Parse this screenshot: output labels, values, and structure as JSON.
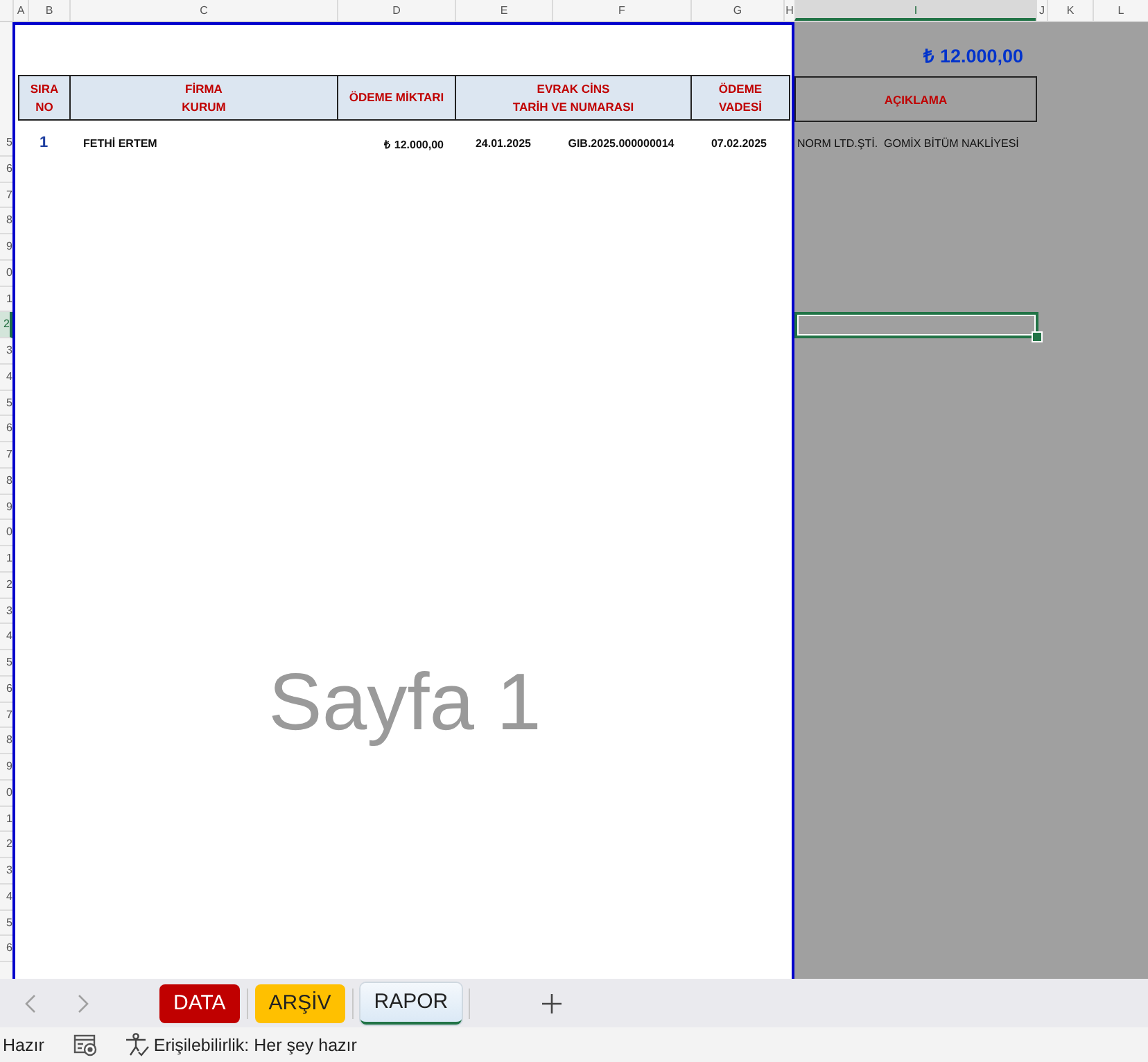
{
  "columns": [
    {
      "label": "A",
      "selected": false
    },
    {
      "label": "B",
      "selected": false
    },
    {
      "label": "C",
      "selected": false
    },
    {
      "label": "D",
      "selected": false
    },
    {
      "label": "E",
      "selected": false
    },
    {
      "label": "F",
      "selected": false
    },
    {
      "label": "G",
      "selected": false
    },
    {
      "label": "H",
      "selected": false
    },
    {
      "label": "I",
      "selected": true
    },
    {
      "label": "J",
      "selected": false
    },
    {
      "label": "K",
      "selected": false
    },
    {
      "label": "L",
      "selected": false
    }
  ],
  "row_headers": [
    {
      "label": "5",
      "selected": false
    },
    {
      "label": "6",
      "selected": false
    },
    {
      "label": "7",
      "selected": false
    },
    {
      "label": "8",
      "selected": false
    },
    {
      "label": "9",
      "selected": false
    },
    {
      "label": "0",
      "selected": false
    },
    {
      "label": "1",
      "selected": false
    },
    {
      "label": "2",
      "selected": true
    },
    {
      "label": "3",
      "selected": false
    },
    {
      "label": "4",
      "selected": false
    },
    {
      "label": "5",
      "selected": false
    },
    {
      "label": "6",
      "selected": false
    },
    {
      "label": "7",
      "selected": false
    },
    {
      "label": "8",
      "selected": false
    },
    {
      "label": "9",
      "selected": false
    },
    {
      "label": "0",
      "selected": false
    },
    {
      "label": "1",
      "selected": false
    },
    {
      "label": "2",
      "selected": false
    },
    {
      "label": "3",
      "selected": false
    },
    {
      "label": "4",
      "selected": false
    },
    {
      "label": "5",
      "selected": false
    },
    {
      "label": "6",
      "selected": false
    },
    {
      "label": "7",
      "selected": false
    },
    {
      "label": "8",
      "selected": false
    },
    {
      "label": "9",
      "selected": false
    },
    {
      "label": "0",
      "selected": false
    },
    {
      "label": "1",
      "selected": false
    },
    {
      "label": "2",
      "selected": false
    },
    {
      "label": "3",
      "selected": false
    },
    {
      "label": "4",
      "selected": false
    },
    {
      "label": "5",
      "selected": false
    },
    {
      "label": "6",
      "selected": false
    }
  ],
  "report": {
    "headers": [
      {
        "lines": [
          "SIRA",
          "NO"
        ]
      },
      {
        "lines": [
          "FİRMA",
          "KURUM"
        ]
      },
      {
        "lines": [
          "ÖDEME MİKTARI"
        ]
      },
      {
        "lines": [
          "EVRAK CİNS",
          "TARİH VE NUMARASI"
        ]
      },
      {
        "lines": [
          "ÖDEME",
          "VADESİ"
        ]
      }
    ],
    "rows": [
      {
        "cells": [
          "1",
          "FETHİ ERTEM",
          "₺ 12.000,00",
          "24.01.2025",
          "GIB.2025.000000014",
          "07.02.2025"
        ]
      }
    ]
  },
  "page_label": "Sayfa 1",
  "side": {
    "total": "₺ 12.000,00",
    "note_header": "AÇIKLAMA",
    "notes": [
      "NORM LTD.ŞTİ.  GOMİX BİTÜM NAKLİYESİ"
    ]
  },
  "sheet_tabs": [
    {
      "label": "DATA",
      "color": "#c00000",
      "selected": false
    },
    {
      "label": "ARŞİV",
      "color": "#ffc000",
      "selected": false
    },
    {
      "label": "RAPOR",
      "color": "#dbe9f6",
      "selected": true
    }
  ],
  "status_bar": {
    "state": "Hazır",
    "accessibility": "Erişilebilirlik: Her şey hazır"
  }
}
